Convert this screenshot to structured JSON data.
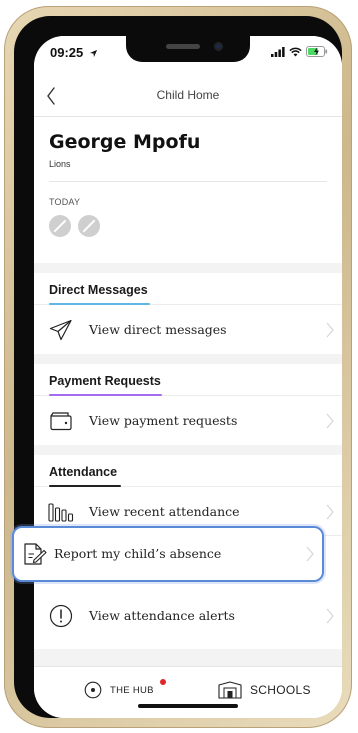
{
  "status_bar": {
    "time": "09:25",
    "location_icon": "location-arrow-icon",
    "signal_icon": "signal-bars-icon",
    "wifi_icon": "wifi-icon",
    "battery_icon": "battery-charging-icon",
    "battery_color": "#4cd964"
  },
  "nav": {
    "title": "Child Home",
    "back_icon": "chevron-left-icon"
  },
  "child": {
    "name": "George Mpofu",
    "group": "Lions",
    "today_label": "TODAY",
    "today_indicators": [
      "slash-circle-icon",
      "slash-circle-icon"
    ]
  },
  "sections": {
    "direct_messages": {
      "header": "Direct Messages",
      "accent_color": "#5fb7e5",
      "items": [
        {
          "label": "View direct messages",
          "icon": "paper-plane-icon"
        }
      ]
    },
    "payment_requests": {
      "header": "Payment Requests",
      "accent_color": "#a46cf0",
      "items": [
        {
          "label": "View payment requests",
          "icon": "wallet-icon"
        }
      ]
    },
    "attendance": {
      "header": "Attendance",
      "accent_color": "#222222",
      "items": [
        {
          "label": "View recent attendance",
          "icon": "bar-chart-icon"
        },
        {
          "label": "Report my child’s absence",
          "icon": "report-document-icon"
        },
        {
          "label": "View attendance alerts",
          "icon": "alert-circle-icon"
        }
      ]
    }
  },
  "tabbar": {
    "hub_label": "THE HUB",
    "hub_icon": "hub-circle-icon",
    "hub_notification_color": "#e0262b",
    "schools_label": "SCHOOLS",
    "schools_icon": "school-building-icon"
  },
  "colors": {
    "highlight_border": "#5b8ad9",
    "background": "#f3f3f3"
  }
}
